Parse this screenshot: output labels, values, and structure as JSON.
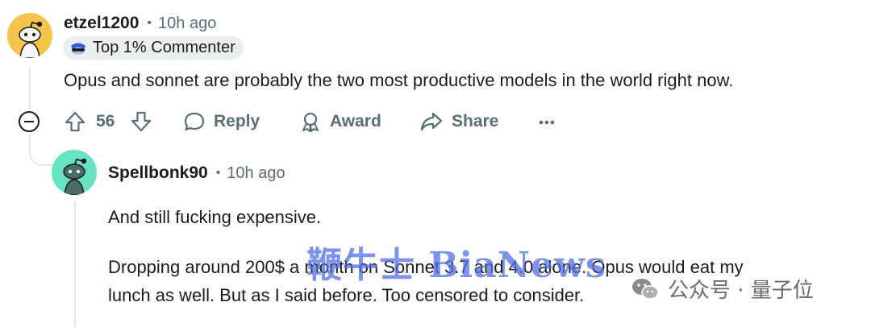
{
  "comment": {
    "username": "etzel1200",
    "separator": "•",
    "time": "10h ago",
    "flair": "Top 1% Commenter",
    "body": "Opus and sonnet are probably the two most productive models in the world right now.",
    "vote_count": "56",
    "actions": {
      "reply": "Reply",
      "award": "Award",
      "share": "Share"
    }
  },
  "reply": {
    "username": "Spellbonk90",
    "separator": "•",
    "time": "10h ago",
    "paragraph1": "And still fucking expensive.",
    "paragraph2_line1": "Dropping around 200$ a month on Sonnet 3.7 and 4.0 alone. Opus would eat my",
    "paragraph2_line2": "lunch as well. But as I said before. Too censored to consider."
  },
  "watermark": {
    "text": "鞭牛士 BiaNews"
  },
  "wechat_mark": {
    "text": "公众号 · 量子位"
  },
  "colors": {
    "avatar1_bg": "#f5c44a",
    "avatar2_bg": "#67e3c2",
    "meta_gray": "#576f76",
    "thread_line": "#e3e6e8",
    "flair_bg": "#e9eef1"
  }
}
